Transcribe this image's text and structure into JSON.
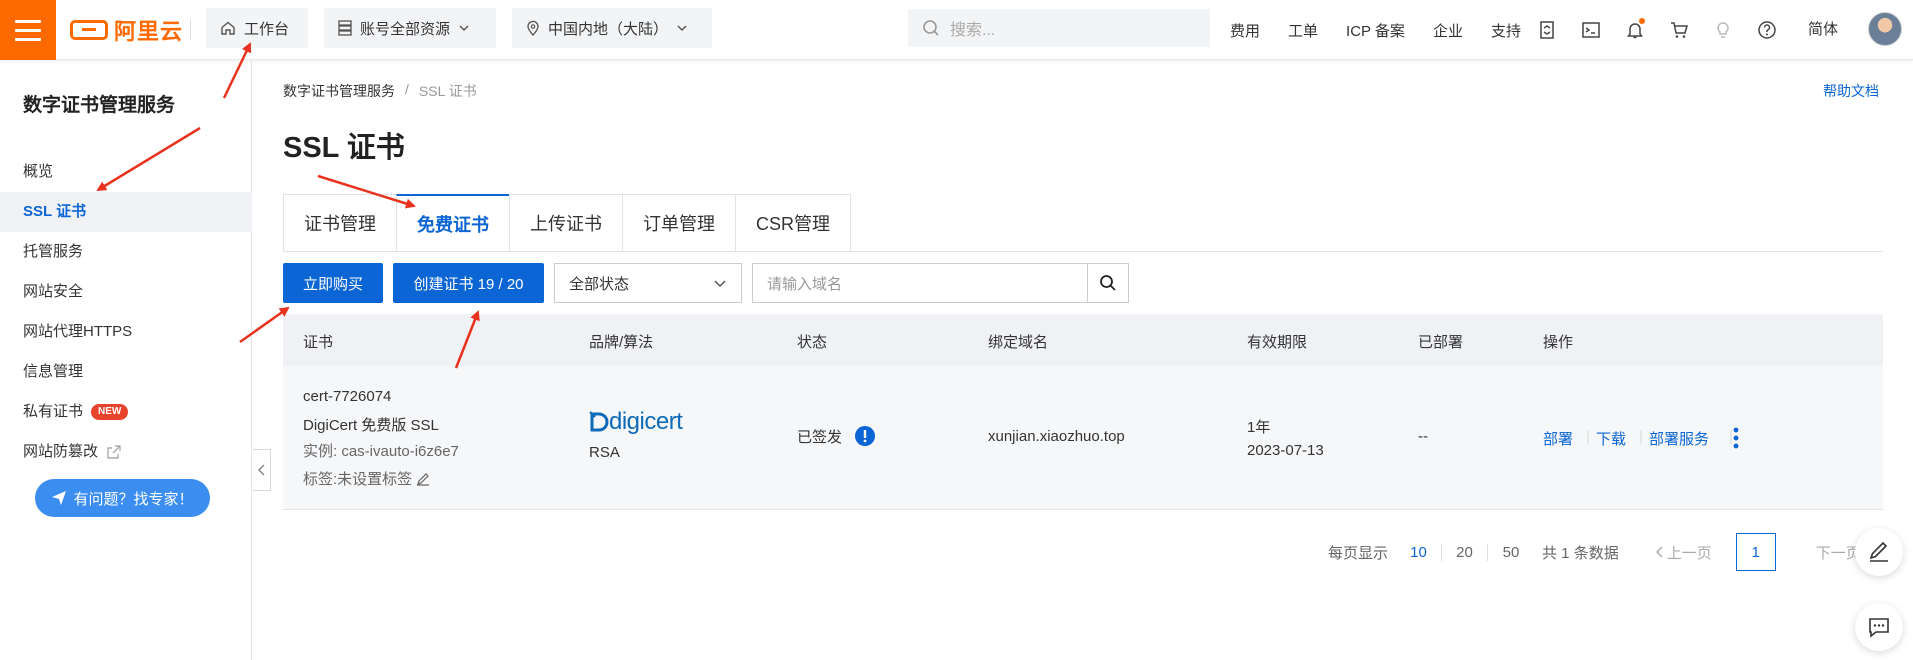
{
  "topbar": {
    "logo_text": "阿里云",
    "workbench": "工作台",
    "resources": "账号全部资源",
    "region": "中国内地（大陆）",
    "search_placeholder": "搜索...",
    "links": [
      "费用",
      "工单",
      "ICP 备案",
      "企业",
      "支持"
    ],
    "lang": "简体",
    "icons": [
      "api-icon",
      "terminal-icon",
      "bell-icon",
      "cart-icon",
      "lightbulb-icon",
      "help-icon"
    ],
    "accent": "#ff6a00"
  },
  "sidebar": {
    "title": "数字证书管理服务",
    "items": [
      {
        "label": "概览"
      },
      {
        "label": "SSL 证书",
        "active": true
      },
      {
        "label": "托管服务"
      },
      {
        "label": "网站安全"
      },
      {
        "label": "网站代理HTTPS"
      },
      {
        "label": "信息管理"
      },
      {
        "label": "私有证书",
        "badge": "NEW"
      },
      {
        "label": "网站防篡改"
      }
    ],
    "expert_button": "有问题？找专家！"
  },
  "breadcrumb": [
    "数字证书管理服务",
    "/",
    "SSL 证书"
  ],
  "help_doc": "帮助文档",
  "page_title": "SSL 证书",
  "tabs": [
    "证书管理",
    "免费证书",
    "上传证书",
    "订单管理",
    "CSR管理"
  ],
  "active_tab": "免费证书",
  "toolbar": {
    "buy_now": "立即购买",
    "create_cert": "创建证书 19 / 20",
    "status_select": "全部状态",
    "domain_placeholder": "请输入域名"
  },
  "table": {
    "headers": [
      "证书",
      "品牌/算法",
      "状态",
      "绑定域名",
      "有效期限",
      "已部署",
      "操作"
    ],
    "rows": [
      {
        "cert_name": "cert-7726074",
        "cert_type": "DigiCert 免费版 SSL",
        "instance": "实例: cas-ivauto-i6z6e7",
        "tag": "标签:未设置标签",
        "brand": "digicert",
        "algorithm": "RSA",
        "status": "已签发",
        "domain": "xunjian.xiaozhuo.top",
        "validity": "1年",
        "expire_date": "2023-07-13",
        "deployed": "--",
        "actions": [
          "部署",
          "下载",
          "部署服务"
        ]
      }
    ]
  },
  "pagination": {
    "per_page_label": "每页显示",
    "sizes": [
      "10",
      "20",
      "50"
    ],
    "current_size": "10",
    "total": "共 1 条数据",
    "prev": "上一页",
    "page": "1",
    "next": "下一页"
  },
  "colors": {
    "primary": "#0b65d4",
    "annotation_arrow": "#e8321e"
  }
}
